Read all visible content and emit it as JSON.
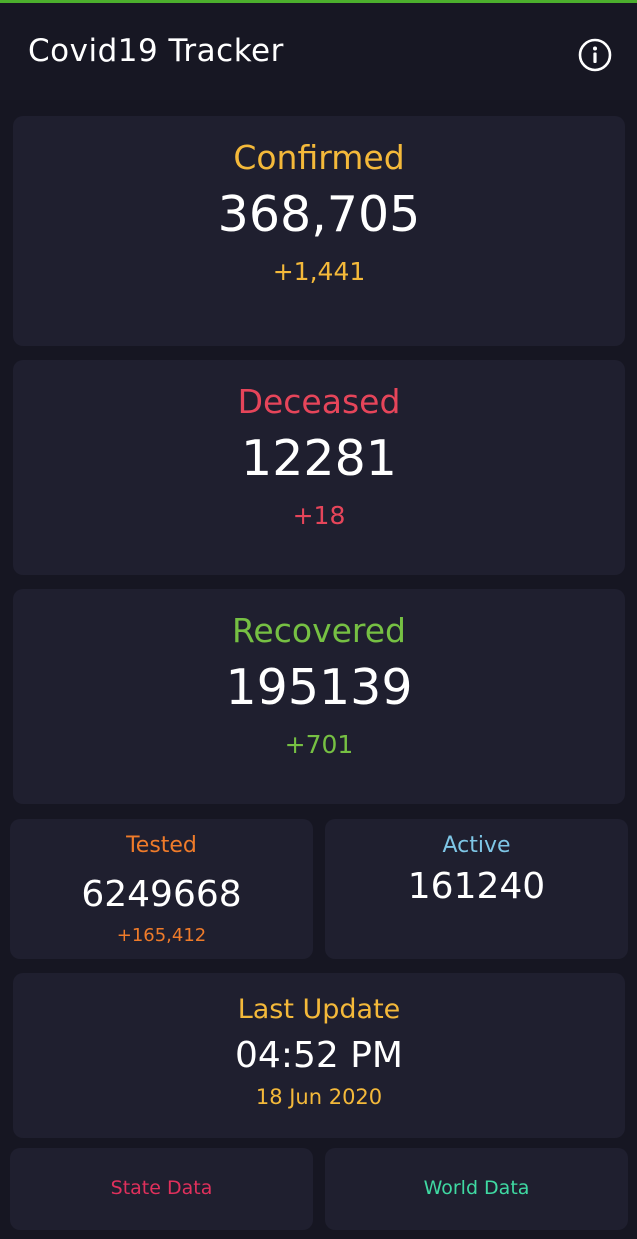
{
  "app": {
    "title": "Covid19 Tracker",
    "info_icon": "info-circle-icon"
  },
  "stats": {
    "confirmed": {
      "label": "Confirmed",
      "value": "368,705",
      "delta": "+1,441"
    },
    "deceased": {
      "label": "Deceased",
      "value": "12281",
      "delta": "+18"
    },
    "recovered": {
      "label": "Recovered",
      "value": "195139",
      "delta": "+701"
    },
    "tested": {
      "label": "Tested",
      "value": "6249668",
      "delta": "+165,412"
    },
    "active": {
      "label": "Active",
      "value": "161240"
    }
  },
  "last_update": {
    "label": "Last Update",
    "time": "04:52 PM",
    "date": "18 Jun 2020"
  },
  "nav": {
    "state_label": "State Data",
    "world_label": "World Data"
  },
  "colors": {
    "confirmed": "#f4b93a",
    "deceased": "#e6455a",
    "recovered": "#76c043",
    "tested": "#ef7b2a",
    "active": "#7ec6e6",
    "state_button": "#e0305c",
    "world_button": "#3fd9a2",
    "background": "#161622",
    "card": "#1f1f2f"
  }
}
